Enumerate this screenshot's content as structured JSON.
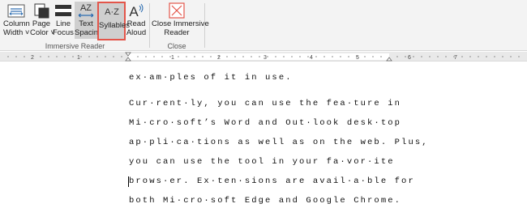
{
  "ribbon": {
    "buttons": {
      "column_width": {
        "line1": "Column",
        "line2": "Width ˅",
        "icon": "column-width-icon"
      },
      "page_color": {
        "line1": "Page",
        "line2": "Color ˅",
        "icon": "page-color-icon"
      },
      "line_focus": {
        "line1": "Line",
        "line2": "Focus ˅",
        "icon": "line-focus-icon"
      },
      "text_spacing": {
        "line1": "Text",
        "line2": "Spacing",
        "icon": "text-spacing-icon",
        "glyph": "AZ"
      },
      "syllables": {
        "line1": "Syllables",
        "icon": "syllables-icon",
        "glyph": "A·Z"
      },
      "read_aloud": {
        "line1": "Read",
        "line2": "Aloud",
        "icon": "read-aloud-icon",
        "glyph": "A"
      },
      "close_immersive": {
        "line1": "Close Immersive",
        "line2": "Reader",
        "icon": "close-icon"
      }
    },
    "groups": {
      "immersive_reader": "Immersive Reader",
      "close": "Close"
    }
  },
  "ruler": {
    "labels": [
      "2",
      "1",
      "1",
      "2",
      "3",
      "4",
      "5",
      "6",
      "7"
    ]
  },
  "document": {
    "lines": [
      "ex·am·ples of it in use.",
      "Cur·rent·ly, you can use the fea·ture in",
      "Mi·cro·soft’s Word and Out·look desk·top",
      "ap·pli·ca·tions as well as on the web. Plus,",
      "you can use the tool in your fa·vor·ite",
      "brows·er. Ex·ten·sions are avail·a·ble for",
      "both Mi·cro·soft Edge and Google Chrome."
    ]
  },
  "colors": {
    "accent_blue": "#2b6cb0",
    "highlight_red": "#e3554a"
  }
}
